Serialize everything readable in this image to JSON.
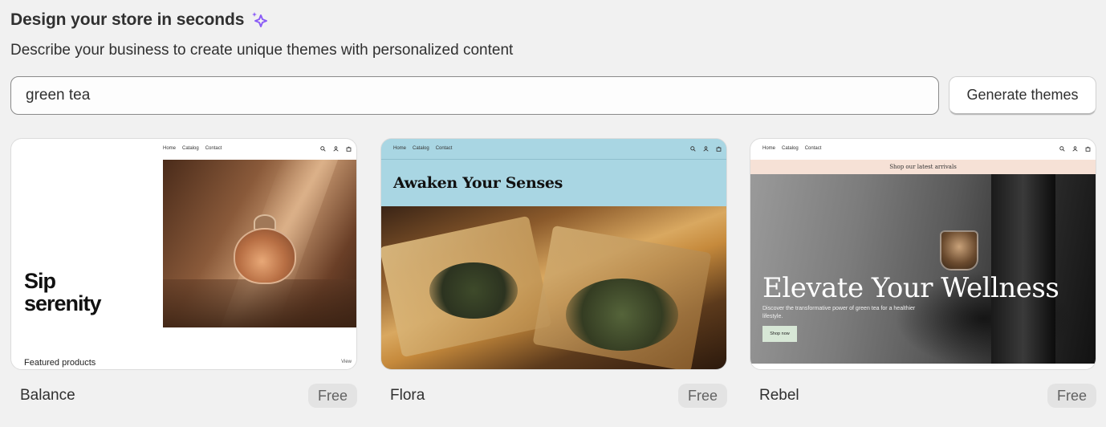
{
  "header": {
    "title": "Design your store in seconds",
    "subtitle": "Describe your business to create unique themes with personalized content",
    "sparkle_icon": "sparkle-icon"
  },
  "prompt": {
    "value": "green tea",
    "button_label": "Generate themes"
  },
  "themes": [
    {
      "name": "Balance",
      "price": "Free",
      "preview": {
        "nav": [
          "Home",
          "Catalog",
          "Contact"
        ],
        "hero": "Sip serenity",
        "hero_line1": "Sip",
        "hero_line2": "serenity",
        "featured": "Featured products",
        "view": "View"
      }
    },
    {
      "name": "Flora",
      "price": "Free",
      "preview": {
        "nav": [
          "Home",
          "Catalog",
          "Contact"
        ],
        "hero": "Awaken Your Senses",
        "bg_color": "#a9d6e3"
      }
    },
    {
      "name": "Rebel",
      "price": "Free",
      "preview": {
        "nav": [
          "Home",
          "Catalog",
          "Contact"
        ],
        "banner": "Shop our latest arrivals",
        "hero": "Elevate Your Wellness",
        "sub": "Discover the transformative power of green tea for a healthier lifestyle.",
        "cta": "Shop now",
        "banner_color": "#f6e1d6"
      }
    }
  ],
  "colors": {
    "background": "#f1f1f1",
    "text": "#303030",
    "badge_bg": "#e3e3e3",
    "sparkle": "#8a5cf6"
  }
}
